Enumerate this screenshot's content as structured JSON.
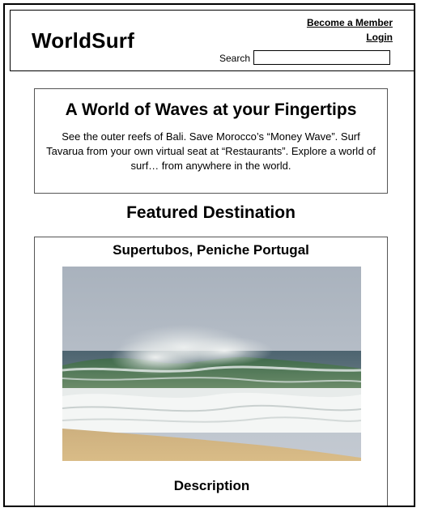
{
  "header": {
    "logo": "WorldSurf",
    "links": [
      "Become a Member",
      "Login"
    ],
    "search": {
      "label": "Search",
      "value": "",
      "placeholder": ""
    }
  },
  "hero": {
    "title": "A World of Waves at your Fingertips",
    "text": "See the outer reefs of Bali. Save Morocco’s “Money Wave”. Surf Tavarua from your own virtual seat at “Restaurants”. Explore a world of surf… from anywhere in the world."
  },
  "featured": {
    "heading": "Featured Destination",
    "destination": {
      "name": "Supertubos, Peniche Portugal",
      "image_icon": "wave-photo",
      "description_heading": "Description"
    }
  }
}
